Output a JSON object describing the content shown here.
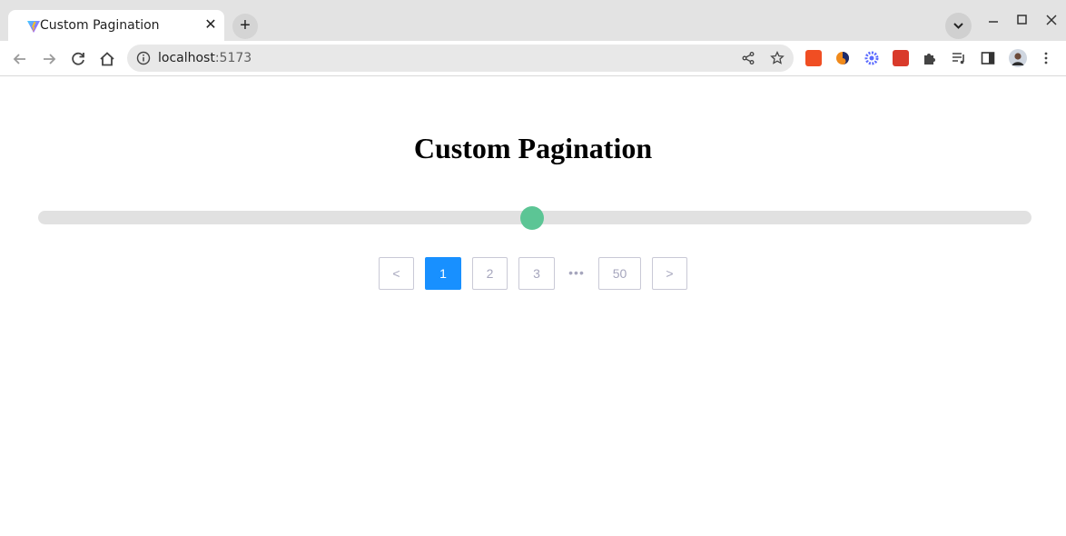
{
  "browser": {
    "tab_title": "Custom Pagination",
    "tab_close": "✕",
    "new_tab": "+",
    "url_host": "localhost",
    "url_port": ":5173"
  },
  "page": {
    "title": "Custom Pagination"
  },
  "slider": {
    "value_fraction": 0.497,
    "colors": {
      "track": "#e1e1e1",
      "thumb": "#5cc595"
    }
  },
  "pagination": {
    "prev_label": "<",
    "next_label": ">",
    "pages": [
      "1",
      "2",
      "3"
    ],
    "ellipsis": "•••",
    "last_page": "50",
    "current_page": "1",
    "colors": {
      "active": "#1890ff",
      "text": "#a6a6bd",
      "border": "#c9c9d6"
    }
  }
}
